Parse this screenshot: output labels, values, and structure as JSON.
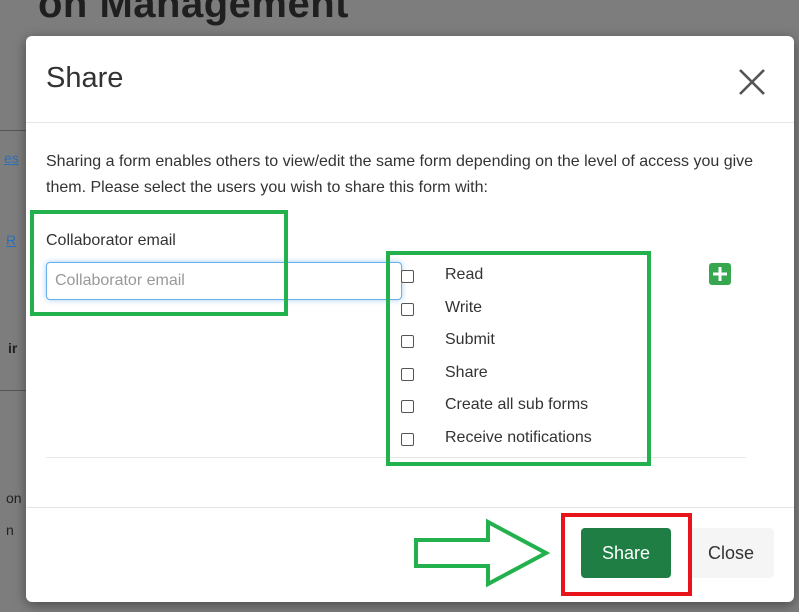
{
  "background": {
    "page_title_fragment": "on Management",
    "link_fragment_1": "es",
    "link_fragment_2": "R",
    "text_fragment_1": "ir",
    "text_fragment_2": "on",
    "text_fragment_3": "n"
  },
  "dialog": {
    "title": "Share",
    "close_icon": "close-x-icon",
    "description": "Sharing a form enables others to view/edit the same form depending on the level of access you give them. Please select the users you wish to share this form with:",
    "email_label": "Collaborator email",
    "email_placeholder": "Collaborator email",
    "email_value": "",
    "permissions": [
      {
        "label": "Read",
        "checked": false
      },
      {
        "label": "Write",
        "checked": false
      },
      {
        "label": "Submit",
        "checked": false
      },
      {
        "label": "Share",
        "checked": false
      },
      {
        "label": "Create all sub forms",
        "checked": false
      },
      {
        "label": "Receive notifications",
        "checked": false
      }
    ],
    "add_icon": "plus-square-icon",
    "share_button": "Share",
    "close_button": "Close"
  },
  "annotations": {
    "highlight_color": "#22b14c",
    "emphasis_color": "#e8141c",
    "arrow_icon": "right-arrow-outline-icon"
  },
  "colors": {
    "primary_button": "#1e7e44",
    "add_button": "#36a64f",
    "input_focus": "#66afe9"
  }
}
